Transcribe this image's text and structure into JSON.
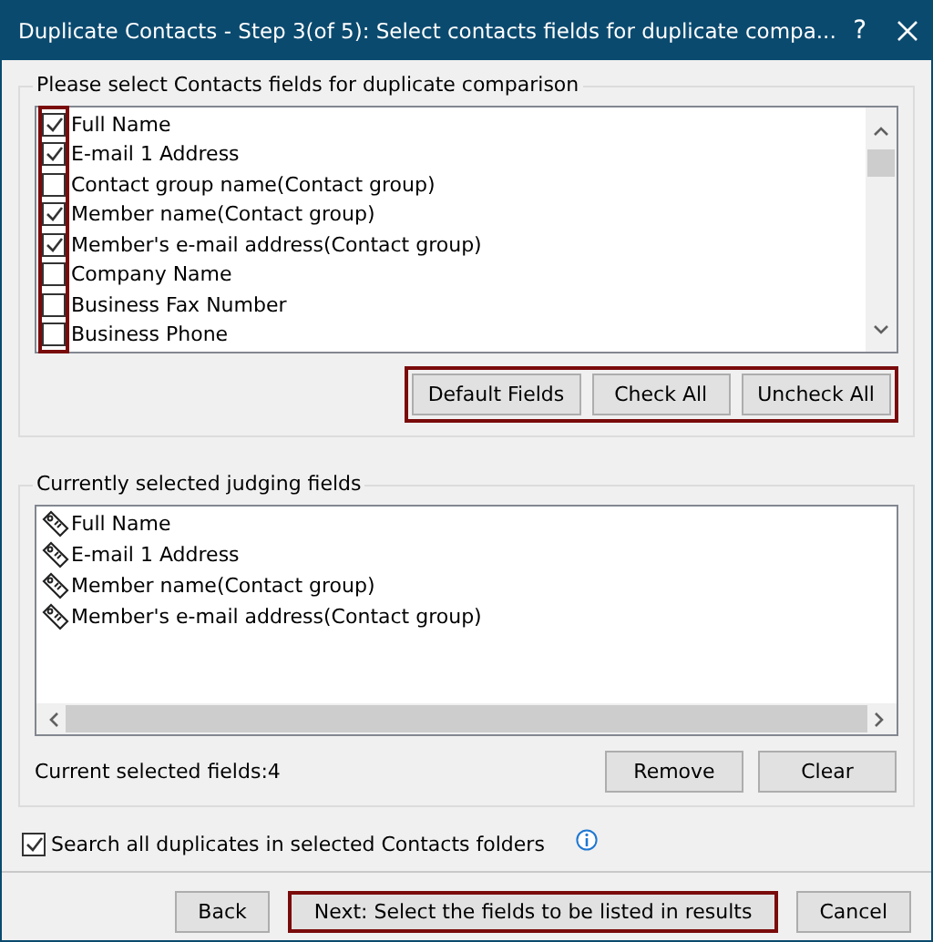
{
  "window": {
    "title": "Duplicate Contacts - Step 3(of 5): Select contacts fields for duplicate compa...",
    "help": "?"
  },
  "fields_group": {
    "title": "Please select Contacts fields for duplicate comparison",
    "items": [
      {
        "label": "Full Name",
        "checked": true
      },
      {
        "label": "E-mail 1 Address",
        "checked": true
      },
      {
        "label": "Contact group name(Contact group)",
        "checked": false
      },
      {
        "label": "Member name(Contact group)",
        "checked": true
      },
      {
        "label": "Member's e-mail address(Contact group)",
        "checked": true
      },
      {
        "label": "Company Name",
        "checked": false
      },
      {
        "label": "Business Fax Number",
        "checked": false
      },
      {
        "label": "Business Phone",
        "checked": false
      }
    ],
    "buttons": [
      "Default Fields",
      "Check All",
      "Uncheck All"
    ]
  },
  "judging_group": {
    "title": "Currently selected judging fields",
    "items": [
      "Full Name",
      "E-mail 1 Address",
      "Member name(Contact group)",
      "Member's e-mail address(Contact group)"
    ],
    "count_label": "Current selected fields:4",
    "buttons": [
      "Remove",
      "Clear"
    ]
  },
  "search_all": {
    "label": "Search all duplicates in selected Contacts folders",
    "checked": true
  },
  "footer_buttons": [
    {
      "label": "Back",
      "highlighted": false
    },
    {
      "label": "Next: Select the fields to be listed in results",
      "highlighted": true
    },
    {
      "label": "Cancel",
      "highlighted": false
    }
  ]
}
